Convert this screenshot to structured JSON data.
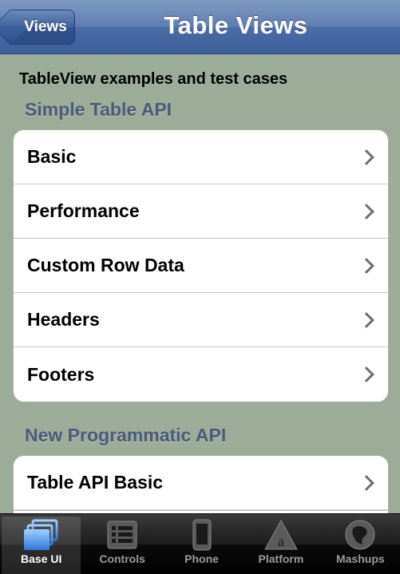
{
  "navbar": {
    "title": "Table Views",
    "back_label": "Views"
  },
  "page": {
    "header": "TableView examples and test cases"
  },
  "sections": [
    {
      "title": "Simple Table API",
      "rows": [
        {
          "label": "Basic"
        },
        {
          "label": "Performance"
        },
        {
          "label": "Custom Row Data"
        },
        {
          "label": "Headers"
        },
        {
          "label": "Footers"
        }
      ]
    },
    {
      "title": "New Programmatic API",
      "rows": [
        {
          "label": "Table API Basic"
        }
      ]
    }
  ],
  "tabbar": {
    "active": "Base UI",
    "tabs": [
      {
        "label": "Base UI",
        "icon": "windows-icon"
      },
      {
        "label": "Controls",
        "icon": "list-icon"
      },
      {
        "label": "Phone",
        "icon": "phone-icon"
      },
      {
        "label": "Platform",
        "icon": "platform-icon"
      },
      {
        "label": "Mashups",
        "icon": "mashups-icon"
      }
    ]
  },
  "colors": {
    "navbar": "#4a6da6",
    "background": "#9cac98",
    "section_header": "#4b5a78",
    "tabbar": "#000000",
    "active_icon": "#4f8fe8"
  }
}
